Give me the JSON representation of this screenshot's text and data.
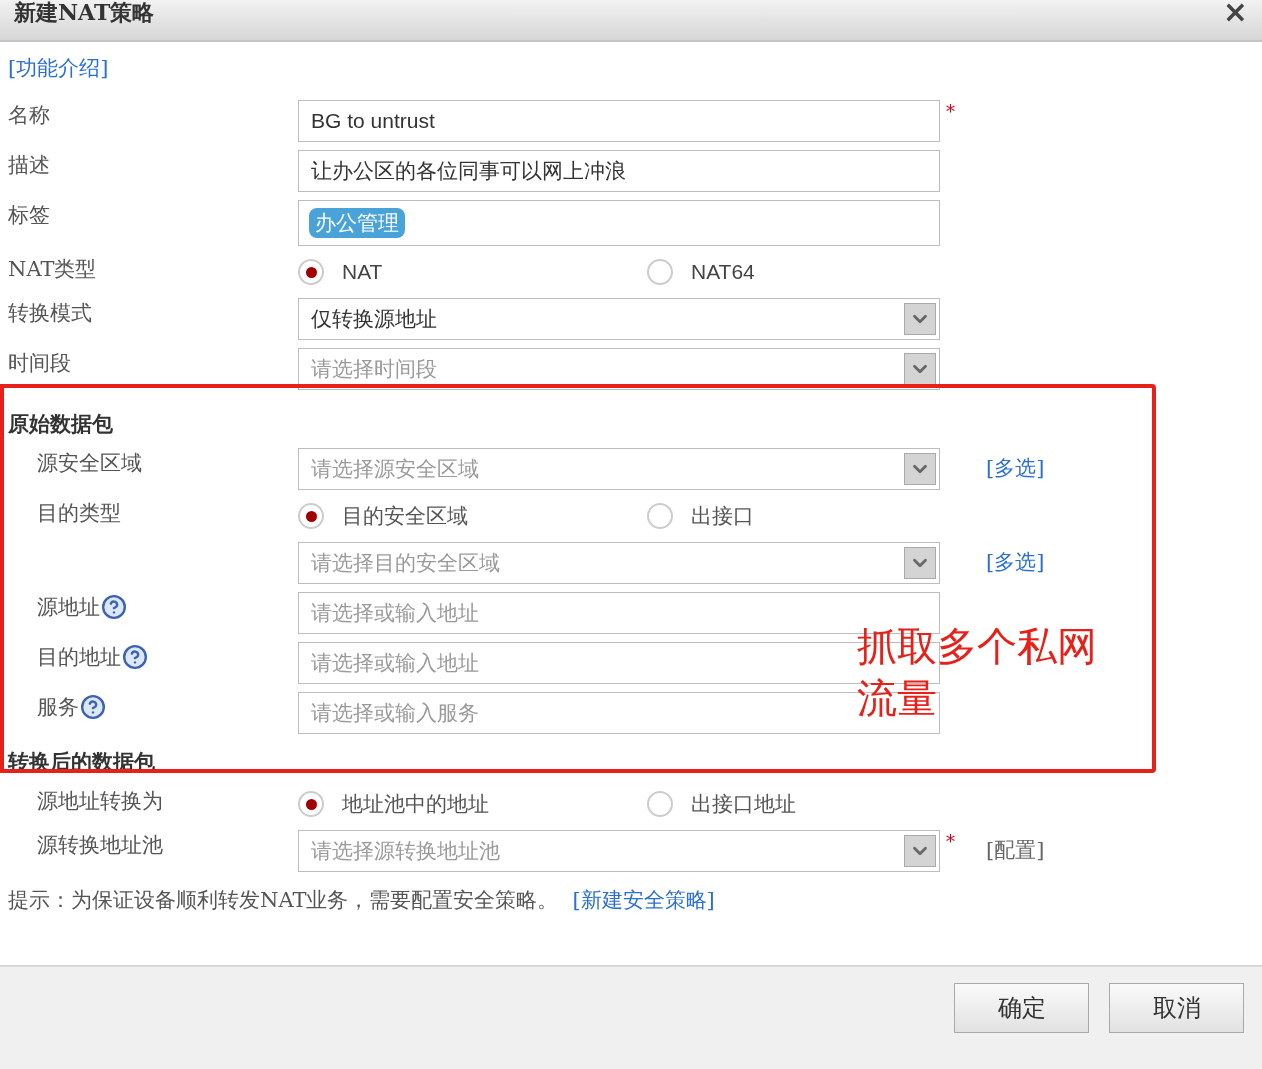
{
  "window": {
    "title": "新建NAT策略",
    "close": "×"
  },
  "intro_link": "[功能介绍]",
  "rows": [
    {
      "kind": "text",
      "label": "名称",
      "value": "BG to untrust",
      "required_mark": "*"
    },
    {
      "kind": "text",
      "label": "描述",
      "value": "让办公区的各位同事可以网上冲浪"
    },
    {
      "kind": "tags",
      "label": "标签",
      "tags": [
        "办公管理"
      ]
    },
    {
      "kind": "radio",
      "label": "NAT类型",
      "options": [
        {
          "label": "NAT",
          "selected": true
        },
        {
          "label": "NAT64",
          "selected": false
        }
      ]
    },
    {
      "kind": "select",
      "label": "转换模式",
      "value": "仅转换源地址"
    },
    {
      "kind": "select",
      "label": "时间段",
      "placeholder": "请选择时间段"
    }
  ],
  "sections": [
    {
      "title": "原始数据包",
      "rows": [
        {
          "kind": "select",
          "label": "源安全区域",
          "placeholder": "请选择源安全区域",
          "extra": {
            "kind": "link",
            "text": "[多选]"
          }
        },
        {
          "kind": "radio",
          "label": "目的类型",
          "options": [
            {
              "label": "目的安全区域",
              "selected": true
            },
            {
              "label": "出接口",
              "selected": false
            }
          ]
        },
        {
          "kind": "select",
          "placeholder": "请选择目的安全区域",
          "extra": {
            "kind": "link",
            "text": "[多选]"
          }
        },
        {
          "kind": "text",
          "label": "源地址",
          "help": true,
          "placeholder": "请选择或输入地址"
        },
        {
          "kind": "text",
          "label": "目的地址",
          "help": true,
          "placeholder": "请选择或输入地址"
        },
        {
          "kind": "text",
          "label": "服务",
          "help": true,
          "placeholder": "请选择或输入服务"
        }
      ]
    },
    {
      "title": "转换后的数据包",
      "rows": [
        {
          "kind": "radio",
          "label": "源地址转换为",
          "options": [
            {
              "label": "地址池中的地址",
              "selected": true
            },
            {
              "label": "出接口地址",
              "selected": false
            }
          ]
        },
        {
          "kind": "select",
          "label": "源转换地址池",
          "placeholder": "请选择源转换地址池",
          "required_mark": "*",
          "extra": {
            "kind": "plain",
            "text": "[配置]"
          }
        }
      ]
    }
  ],
  "tip": {
    "text": "提示：为保证设备顺利转发NAT业务，需要配置安全策略。",
    "link": "[新建安全策略]"
  },
  "buttons": [
    "确定",
    "取消"
  ],
  "annotation": {
    "text": "抓取多个私网流量"
  }
}
